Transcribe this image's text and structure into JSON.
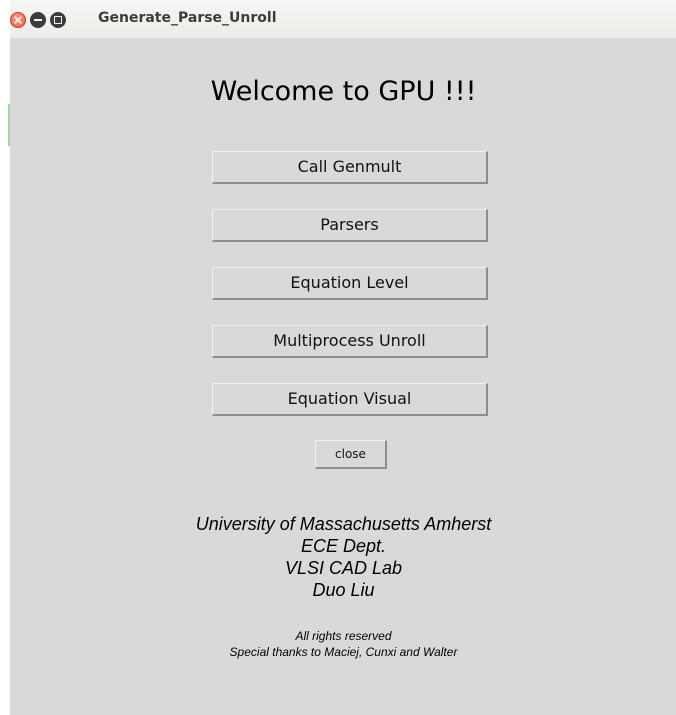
{
  "window": {
    "title": "Generate_Parse_Unroll"
  },
  "main": {
    "heading": "Welcome to GPU !!!",
    "buttons": [
      {
        "label": "Call Genmult"
      },
      {
        "label": "Parsers"
      },
      {
        "label": "Equation Level"
      },
      {
        "label": "Multiprocess Unroll"
      },
      {
        "label": "Equation Visual"
      }
    ],
    "close_label": "close"
  },
  "credits": {
    "university": "University of Massachusetts Amherst",
    "dept": "ECE Dept.",
    "lab": "VLSI CAD Lab",
    "author": "Duo Liu",
    "rights": "All rights reserved",
    "thanks": "Special thanks to Maciej, Cunxi and Walter"
  },
  "colors": {
    "background": "#d9d9d9",
    "close_button": "#e2553f"
  }
}
